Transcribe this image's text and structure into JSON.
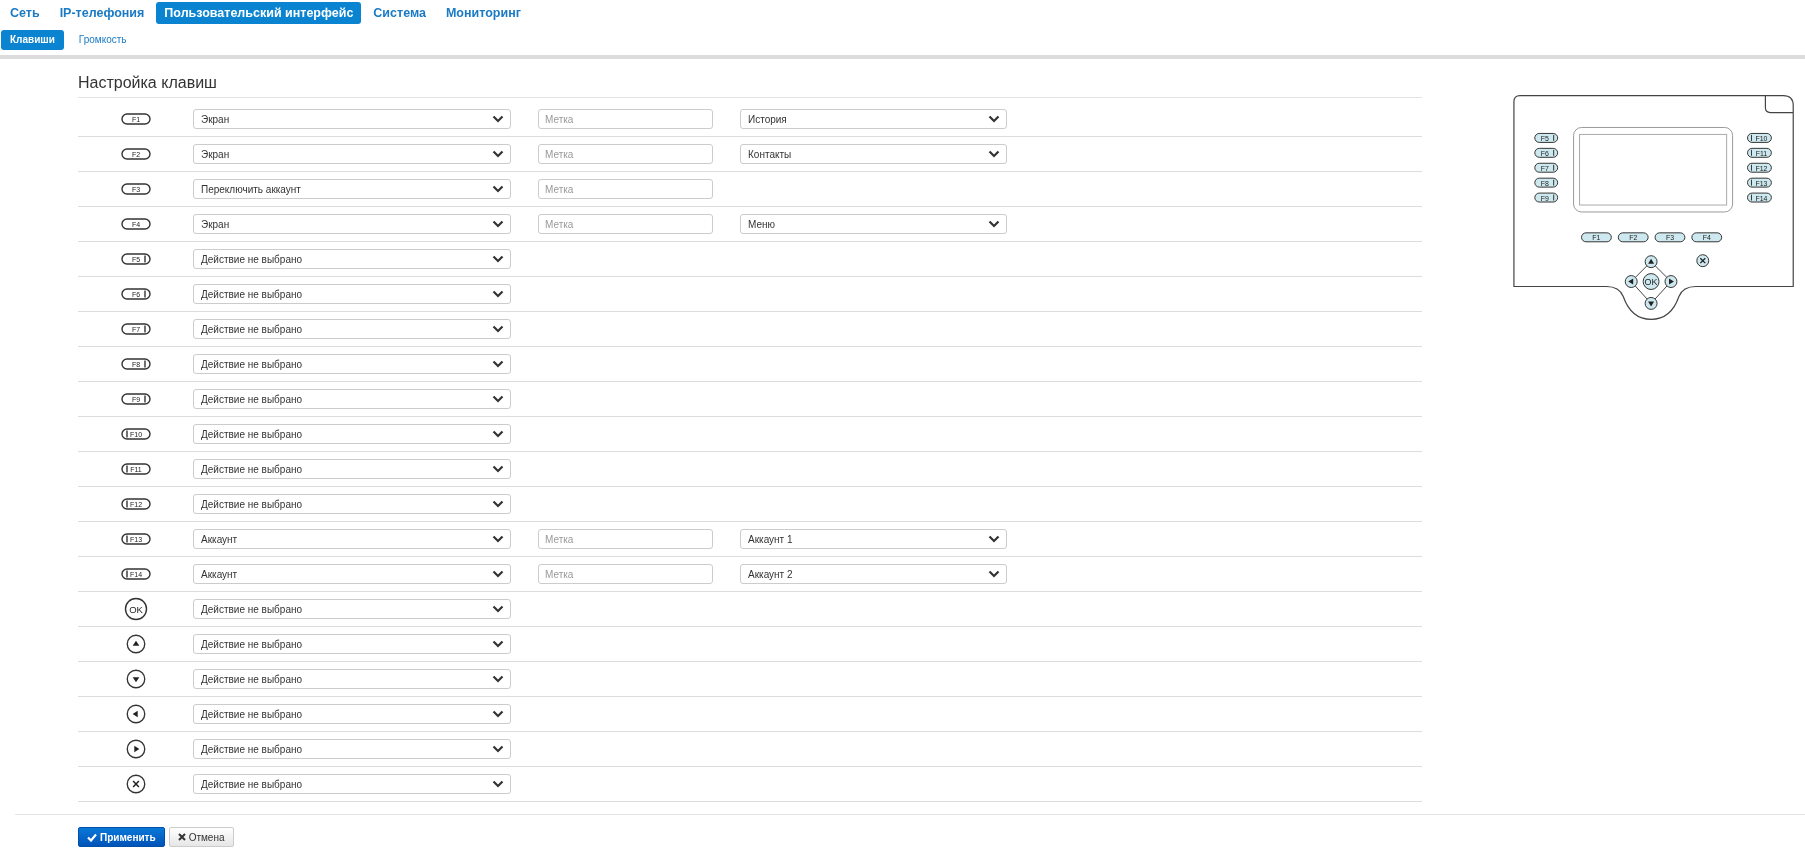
{
  "nav": {
    "tabs": [
      {
        "label": "Сеть",
        "selected": false
      },
      {
        "label": "IP-телефония",
        "selected": false
      },
      {
        "label": "Пользовательский интерфейс",
        "selected": true
      },
      {
        "label": "Система",
        "selected": false
      },
      {
        "label": "Мониторинг",
        "selected": false
      }
    ]
  },
  "subtabs": [
    {
      "label": "Клавиши",
      "selected": true
    },
    {
      "label": "Громкость",
      "selected": false
    }
  ],
  "title": "Настройка клавиш",
  "rows": [
    {
      "key": {
        "kind": "pill",
        "label": "F1"
      },
      "action": "Экран",
      "label_placeholder": "Метка",
      "target": "История"
    },
    {
      "key": {
        "kind": "pill",
        "label": "F2"
      },
      "action": "Экран",
      "label_placeholder": "Метка",
      "target": "Контакты"
    },
    {
      "key": {
        "kind": "pill",
        "label": "F3"
      },
      "action": "Переключить аккаунт",
      "label_placeholder": "Метка"
    },
    {
      "key": {
        "kind": "pill",
        "label": "F4"
      },
      "action": "Экран",
      "label_placeholder": "Метка",
      "target": "Меню"
    },
    {
      "key": {
        "kind": "pill-right",
        "label": "F5"
      },
      "action": "Действие не выбрано"
    },
    {
      "key": {
        "kind": "pill-right",
        "label": "F6"
      },
      "action": "Действие не выбрано"
    },
    {
      "key": {
        "kind": "pill-right",
        "label": "F7"
      },
      "action": "Действие не выбрано"
    },
    {
      "key": {
        "kind": "pill-right",
        "label": "F8"
      },
      "action": "Действие не выбрано"
    },
    {
      "key": {
        "kind": "pill-right",
        "label": "F9"
      },
      "action": "Действие не выбрано"
    },
    {
      "key": {
        "kind": "pill-left",
        "label": "F10"
      },
      "action": "Действие не выбрано"
    },
    {
      "key": {
        "kind": "pill-left",
        "label": "F11"
      },
      "action": "Действие не выбрано"
    },
    {
      "key": {
        "kind": "pill-left",
        "label": "F12"
      },
      "action": "Действие не выбрано"
    },
    {
      "key": {
        "kind": "pill-left",
        "label": "F13"
      },
      "action": "Аккаунт",
      "label_placeholder": "Метка",
      "target": "Аккаунт 1"
    },
    {
      "key": {
        "kind": "pill-left",
        "label": "F14"
      },
      "action": "Аккаунт",
      "label_placeholder": "Метка",
      "target": "Аккаунт 2"
    },
    {
      "key": {
        "kind": "ok",
        "label": "OK"
      },
      "action": "Действие не выбрано"
    },
    {
      "key": {
        "kind": "up"
      },
      "action": "Действие не выбрано"
    },
    {
      "key": {
        "kind": "down"
      },
      "action": "Действие не выбрано"
    },
    {
      "key": {
        "kind": "left"
      },
      "action": "Действие не выбрано"
    },
    {
      "key": {
        "kind": "right"
      },
      "action": "Действие не выбрано"
    },
    {
      "key": {
        "kind": "cancel"
      },
      "action": "Действие не выбрано"
    }
  ],
  "phone": {
    "left_keys": [
      "F5",
      "F6",
      "F7",
      "F8",
      "F9"
    ],
    "right_keys": [
      "F10",
      "F11",
      "F12",
      "F13",
      "F14"
    ],
    "bottom_keys": [
      "F1",
      "F2",
      "F3",
      "F4"
    ],
    "ok_label": "OK"
  },
  "buttons": [
    {
      "kind": "primary",
      "label": "Применить"
    },
    {
      "kind": "cancel",
      "label": "Отмена"
    }
  ]
}
